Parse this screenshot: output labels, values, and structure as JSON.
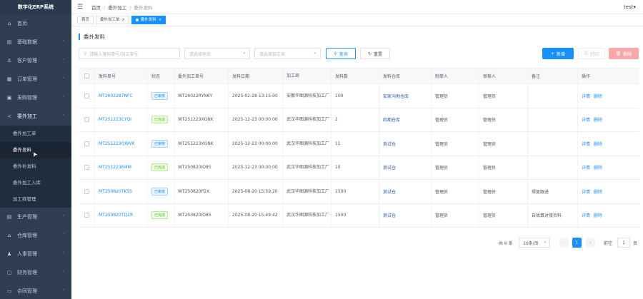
{
  "sidebar": {
    "logo": "数字化ERP系统",
    "items": [
      {
        "label": "首页",
        "icon": "home-icon",
        "glyph": "⌂"
      },
      {
        "label": "基础数据",
        "icon": "database-icon",
        "glyph": "▤"
      },
      {
        "label": "客户管理",
        "icon": "user-icon",
        "glyph": "♙"
      },
      {
        "label": "订单管理",
        "icon": "order-icon",
        "glyph": "▦"
      },
      {
        "label": "采购管理",
        "icon": "purchase-icon",
        "glyph": "▣"
      },
      {
        "label": "委外加工",
        "icon": "share-icon",
        "glyph": "≺"
      }
    ],
    "sub_items": [
      {
        "label": "委外加工单"
      },
      {
        "label": "委外发料"
      },
      {
        "label": "委外补发料"
      },
      {
        "label": "委外加工入库"
      },
      {
        "label": "加工商管理"
      }
    ],
    "bottom_items": [
      {
        "label": "生产管理",
        "icon": "production-icon",
        "glyph": "▤"
      },
      {
        "label": "仓库管理",
        "icon": "warehouse-icon",
        "glyph": "⌂"
      },
      {
        "label": "人事管理",
        "icon": "people-icon",
        "glyph": "♟"
      },
      {
        "label": "财务管理",
        "icon": "finance-icon",
        "glyph": "▢"
      },
      {
        "label": "合同管理",
        "icon": "contract-icon",
        "glyph": "▭"
      }
    ]
  },
  "topbar": {
    "crumbs": [
      "首页",
      "委外加工",
      "委外发料"
    ],
    "user": "test▾"
  },
  "tags": [
    {
      "label": "首页",
      "active": false
    },
    {
      "label": "委外加工单",
      "active": false
    },
    {
      "label": "委外发料",
      "active": true
    }
  ],
  "page": {
    "title": "委外发料",
    "filters": {
      "no_placeholder": "请输入发料单号/加工单号",
      "processor_placeholder": "请选择状态",
      "date_placeholder": "请选择加工商"
    },
    "buttons": {
      "search": "查询",
      "reset": "重置",
      "add": "新增",
      "print": "打印",
      "delete": "删除"
    }
  },
  "table": {
    "headers": [
      "发料单号",
      "状态",
      "委外加工单号",
      "发料日期",
      "加工商",
      "发料数",
      "发料仓库",
      "制单人",
      "审核人",
      "备注",
      "操作"
    ],
    "rows": [
      {
        "no": "MT2602287NFC",
        "status": "已审核",
        "status_type": "blue",
        "order": "WT26022RYN6Y",
        "date": "2025-02-28 13:15:00",
        "vendor": "安徽华图源科技加工厂",
        "qty": "100",
        "warehouse": "安家沟地仓库",
        "creator": "管理员",
        "auditor": "管理员",
        "remark": "",
        "ops": [
          "详情",
          "删除"
        ]
      },
      {
        "no": "MT251223CYQI",
        "status": "已完成",
        "status_type": "green",
        "order": "WT251223XGNK",
        "date": "2025-12-23 00:00:00",
        "vendor": "武汉华图源科技加工厂",
        "qty": "2",
        "warehouse": "四期仓库",
        "creator": "管理员",
        "auditor": "管理员",
        "remark": "",
        "ops": [
          "详情",
          "删除"
        ]
      },
      {
        "no": "MT251223QWVK",
        "status": "已审核",
        "status_type": "blue",
        "order": "WT251223XGNK",
        "date": "2025-12-23 00:00:00",
        "vendor": "武汉华图源科技加工厂",
        "qty": "11",
        "warehouse": "测试仓",
        "creator": "管理员",
        "auditor": "管理员",
        "remark": "",
        "ops": [
          "详情",
          "删除"
        ]
      },
      {
        "no": "MT251223M4M",
        "status": "已完成",
        "status_type": "green",
        "order": "WT250820IO85",
        "date": "2025-12-23 00:00:00",
        "vendor": "武汉华图源科技加工厂",
        "qty": "10",
        "warehouse": "测试仓",
        "creator": "管理员",
        "auditor": "管理员",
        "remark": "",
        "ops": [
          "详情",
          "删除"
        ]
      },
      {
        "no": "MT250820TK5S",
        "status": "已审核",
        "status_type": "blue",
        "order": "WT250820P2X",
        "date": "2025-08-20 15:59:20",
        "vendor": "武汉华图源科技加工厂",
        "qty": "1500",
        "warehouse": "测试仓",
        "creator": "管理员",
        "auditor": "管理员",
        "remark": "得复跟进",
        "ops": [
          "详情",
          "删除"
        ]
      },
      {
        "no": "MT250820TQ2R",
        "status": "已完成",
        "status_type": "green",
        "order": "WT250820IO85",
        "date": "2025-08-20 15:49:42",
        "vendor": "武汉华图源科技加工厂",
        "qty": "1500",
        "warehouse": "测试仓",
        "creator": "管理员",
        "auditor": "管理员",
        "remark": "自估算对接农料",
        "ops": [
          "详情",
          "删除"
        ]
      }
    ]
  },
  "pager": {
    "total": "共 6 条",
    "size": "10条/页",
    "current": "1",
    "goto_label": "前往",
    "goto_value": "1",
    "unit": "页"
  },
  "colors": {
    "accent": "#1890ff",
    "sidebar": "#2f3e52",
    "danger_light": "#f8a8a8"
  }
}
